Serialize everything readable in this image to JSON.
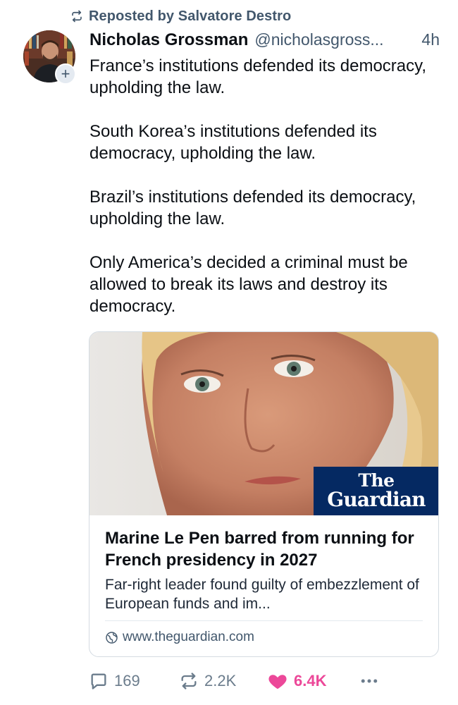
{
  "repost": {
    "label": "Reposted by Salvatore Destro",
    "icon": "repost-icon"
  },
  "author": {
    "name": "Nicholas Grossman",
    "handle": "@nicholasgross...",
    "time": "4h",
    "follow_label": "+"
  },
  "post": {
    "paragraphs": [
      "France’s institutions defended its democracy, upholding the law.",
      "South Korea’s institutions defended its democracy, upholding the law.",
      "Brazil’s institutions defended its democracy, upholding the law.",
      "Only America’s decided a criminal must be allowed to break its laws and destroy its democracy."
    ]
  },
  "card": {
    "logo_line1": "The",
    "logo_line2": "Guardian",
    "title": "Marine Le Pen barred from running for French presidency in 2027",
    "description": "Far-right leader found guilty of embezzlement of European funds and im...",
    "domain": "www.theguardian.com",
    "logo_color": "#052962"
  },
  "actions": {
    "replies": "169",
    "reposts": "2.2K",
    "likes": "6.4K",
    "like_color": "#ec4899"
  }
}
